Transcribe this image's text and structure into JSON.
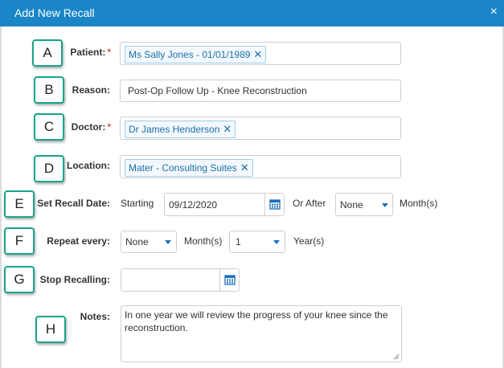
{
  "dialog": {
    "title": "Add New Recall",
    "close_glyph": "×"
  },
  "badges": [
    "A",
    "B",
    "C",
    "D",
    "E",
    "F",
    "G",
    "H"
  ],
  "patient": {
    "label": "Patient:",
    "required_mark": "*",
    "value": "Ms Sally Jones - 01/01/1989",
    "remove_glyph": "✕"
  },
  "reason": {
    "label": "Reason:",
    "value": "Post-Op Follow Up - Knee Reconstruction"
  },
  "doctor": {
    "label": "Doctor:",
    "required_mark": "*",
    "value": "Dr James Henderson",
    "remove_glyph": "✕"
  },
  "location": {
    "label": "Location:",
    "value": "Mater - Consulting Suites",
    "remove_glyph": "✕"
  },
  "recall_date": {
    "label": "Set Recall Date:",
    "starting_label": "Starting",
    "starting_value": "09/12/2020",
    "or_after_label": "Or After",
    "or_after_value": "None",
    "unit_label": "Month(s)"
  },
  "repeat": {
    "label": "Repeat every:",
    "months_value": "None",
    "months_label": "Month(s)",
    "years_value": "1",
    "years_label": "Year(s)"
  },
  "stop": {
    "label": "Stop Recalling:",
    "value": ""
  },
  "notes": {
    "label": "Notes:",
    "value": "In one year we will review the progress of your knee since the reconstruction."
  },
  "colors": {
    "titlebar": "#1a86c8",
    "badge_border": "#17a589",
    "tag_text": "#1d6fa8",
    "required": "#d9534f"
  }
}
